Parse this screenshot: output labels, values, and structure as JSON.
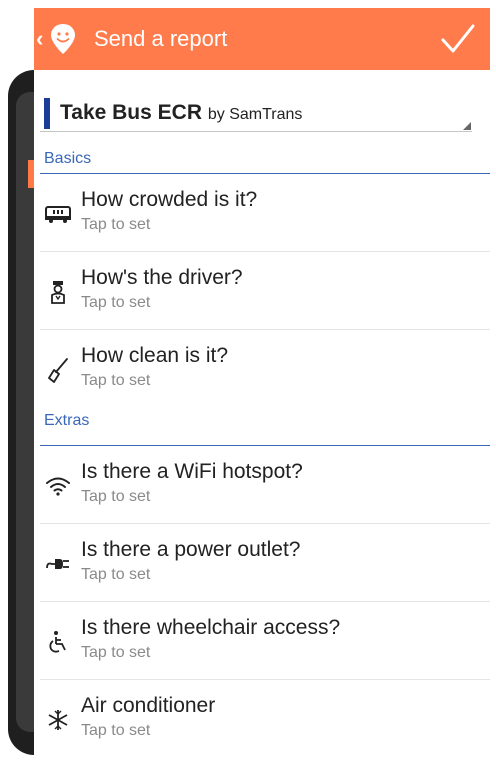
{
  "colors": {
    "appbar": "#ff7b4b",
    "section_accent": "#3a67b8",
    "route_marker": "#1a3d98"
  },
  "appbar": {
    "title": "Send a report"
  },
  "route": {
    "name": "Take Bus ECR",
    "by": "by SamTrans"
  },
  "sections": {
    "basics": {
      "label": "Basics"
    },
    "extras": {
      "label": "Extras"
    }
  },
  "items": [
    {
      "icon": "bus-crowd-icon",
      "title": "How crowded is it?",
      "sub": "Tap to set"
    },
    {
      "icon": "driver-icon",
      "title": "How's the driver?",
      "sub": "Tap to set"
    },
    {
      "icon": "broom-icon",
      "title": "How clean is it?",
      "sub": "Tap to set"
    },
    {
      "icon": "wifi-icon",
      "title": "Is there a WiFi hotspot?",
      "sub": "Tap to set"
    },
    {
      "icon": "power-plug-icon",
      "title": "Is there a power outlet?",
      "sub": "Tap to set"
    },
    {
      "icon": "wheelchair-icon",
      "title": "Is there wheelchair access?",
      "sub": "Tap to set"
    },
    {
      "icon": "snowflake-icon",
      "title": "Air conditioner",
      "sub": "Tap to set"
    }
  ]
}
